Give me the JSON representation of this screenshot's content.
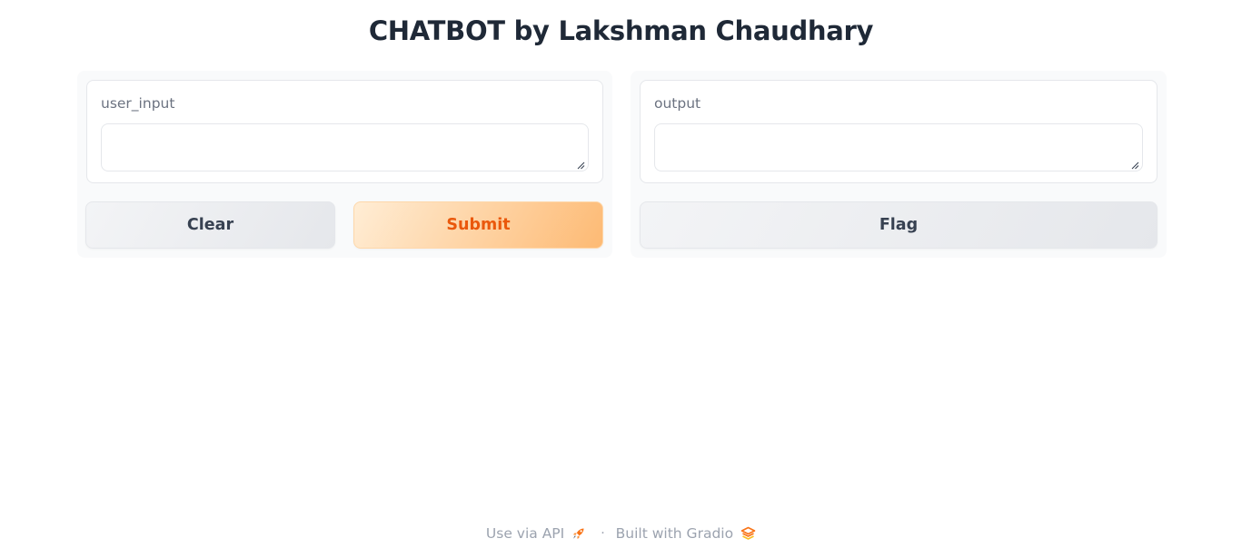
{
  "header": {
    "title": "CHATBOT by Lakshman Chaudhary"
  },
  "input_panel": {
    "label": "user_input",
    "value": "",
    "placeholder": "",
    "clear_label": "Clear",
    "submit_label": "Submit"
  },
  "output_panel": {
    "label": "output",
    "value": "",
    "flag_label": "Flag"
  },
  "footer": {
    "api_link": "Use via API",
    "separator": "·",
    "built_with": "Built with Gradio",
    "api_icon": "rocket-icon",
    "gradio_icon": "gradio-logo-icon"
  },
  "colors": {
    "accent": "#ea580c",
    "primary_gradient_start": "#ffedd5",
    "primary_gradient_end": "#fdba74",
    "panel_bg": "#f9fafb",
    "border": "#e5e7eb",
    "muted_text": "#6b7280"
  }
}
